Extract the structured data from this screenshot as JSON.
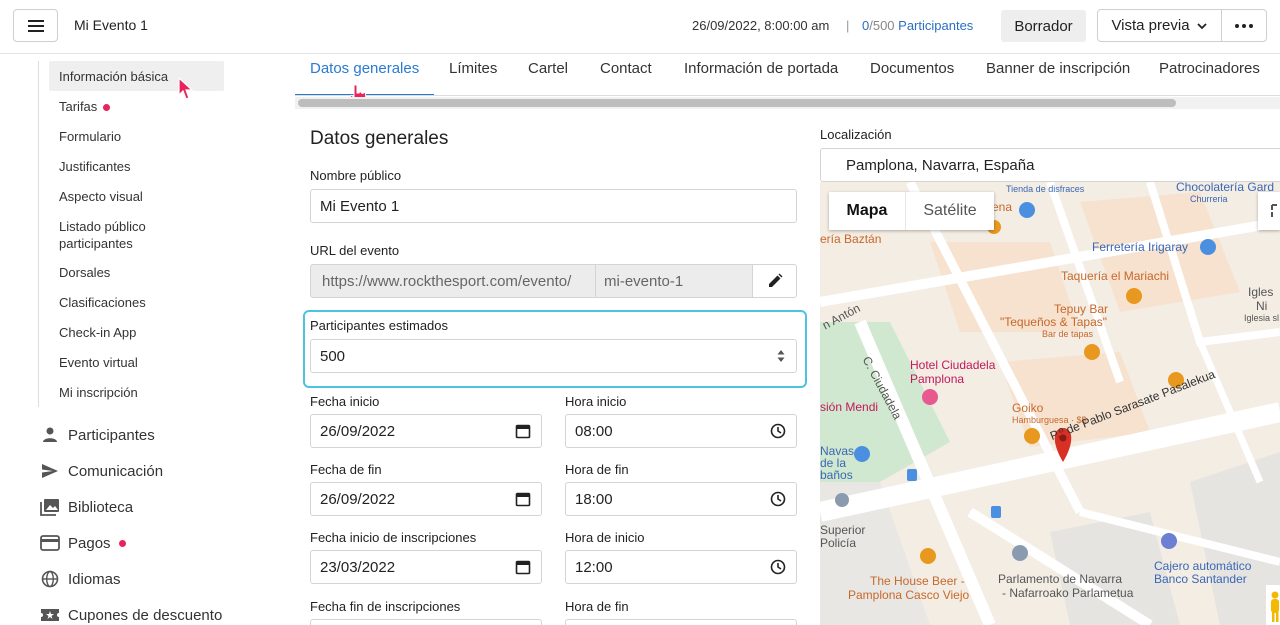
{
  "header": {
    "event_title": "Mi Evento 1",
    "date": "26/09/2022, 8:00:00 am",
    "separator": "|",
    "participants_current": "0",
    "participants_max": "/500",
    "participants_label": " Participantes",
    "draft_label": "Borrador",
    "preview_label": "Vista previa"
  },
  "sidebar": {
    "sub_items": [
      {
        "label": "Información básica"
      },
      {
        "label": "Tarifas"
      },
      {
        "label": "Formulario"
      },
      {
        "label": "Justificantes"
      },
      {
        "label": "Aspecto visual"
      },
      {
        "label": "Listado público participantes"
      },
      {
        "label": "Dorsales"
      },
      {
        "label": "Clasificaciones"
      },
      {
        "label": "Check-in App"
      },
      {
        "label": "Evento virtual"
      },
      {
        "label": "Mi inscripción"
      }
    ],
    "main_items": [
      {
        "label": "Participantes",
        "icon": "person-icon"
      },
      {
        "label": "Comunicación",
        "icon": "send-icon"
      },
      {
        "label": "Biblioteca",
        "icon": "photo-library-icon"
      },
      {
        "label": "Pagos",
        "icon": "credit-card-icon"
      },
      {
        "label": "Idiomas",
        "icon": "globe-icon"
      },
      {
        "label": "Cupones de descuento",
        "icon": "coupon-icon"
      }
    ],
    "dot_color": "#e8245b"
  },
  "tabs": [
    {
      "label": "Datos generales"
    },
    {
      "label": "Límites"
    },
    {
      "label": "Cartel"
    },
    {
      "label": "Contact"
    },
    {
      "label": "Información de portada"
    },
    {
      "label": "Documentos"
    },
    {
      "label": "Banner de inscripción"
    },
    {
      "label": "Patrocinadores"
    }
  ],
  "form": {
    "title": "Datos generales",
    "public_name_label": "Nombre público",
    "public_name_value": "Mi Evento 1",
    "url_label": "URL del evento",
    "url_prefix": "https://www.rockthesport.com/evento/",
    "url_slug": "mi-evento-1",
    "est_participants_label": "Participantes estimados",
    "est_participants_value": "500",
    "start_date_label": "Fecha inicio",
    "start_date_value": "26/09/2022",
    "start_time_label": "Hora inicio",
    "start_time_value": "08:00",
    "end_date_label": "Fecha de fin",
    "end_date_value": "26/09/2022",
    "end_time_label": "Hora de fin",
    "end_time_value": "18:00",
    "reg_start_date_label": "Fecha inicio de inscripciones",
    "reg_start_date_value": "23/03/2022",
    "reg_start_time_label": "Hora de inicio",
    "reg_start_time_value": "12:00",
    "reg_end_date_label": "Fecha fin de inscripciones",
    "reg_end_time_label": "Hora de fin"
  },
  "location": {
    "label": "Localización",
    "value": "Pamplona, Navarra, España",
    "map_type_map": "Mapa",
    "map_type_satellite": "Satélite",
    "places": {
      "p1": "Tienda de disfraces",
      "p2": "Chocolatería Gard",
      "p3": "Churreria",
      "p4": "ena",
      "p5": "ería Baztán",
      "p6": "Ferretería Irigaray",
      "p7": "Taquería el Mariachi",
      "p8": "Tepuy Bar",
      "p9": "\"Tequeños & Tapas\"",
      "p10": "Bar de tapas",
      "p11": "Igles",
      "p12": "Ni",
      "p13": "Iglesia sl",
      "p14": "Hotel Ciudadela",
      "p15": "Pamplona",
      "p16": "Goiko",
      "p17": "Hamburguesa · $$",
      "p18": "sión Mendi",
      "p19": "Navas",
      "p20": "de la",
      "p21": "baños",
      "p22": "Superior",
      "p23": "Policía",
      "p24": "The House Beer -",
      "p25": "Pamplona Casco Viejo",
      "p26": "Parlamento de Navarra",
      "p27": "- Nafarroako Parlametua",
      "p28": "Cajero automático",
      "p29": "Banco Santander",
      "street1": "P.º de Pablo Sarasate Pasalekua",
      "street2": "C. Ciudadela",
      "street3": "n Antón"
    },
    "colors": {
      "road": "#ffffff",
      "park": "#cfe8cf",
      "block": "#e8e6e3",
      "poi_orange": "#e8981e",
      "poi_blue": "#4a8fe0",
      "marker": "#d93025"
    }
  }
}
